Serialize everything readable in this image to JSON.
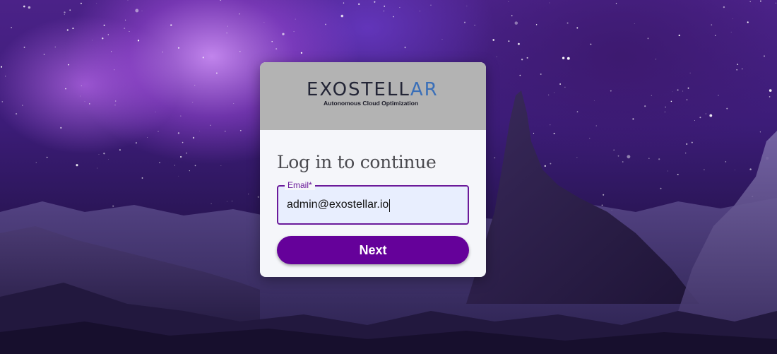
{
  "brand": {
    "logo_word_dark": "EXOSTELL",
    "logo_word_blue": "AR",
    "tagline": "Autonomous Cloud Optimization"
  },
  "login": {
    "title": "Log in to continue",
    "email_label": "Email",
    "email_required_marker": "*",
    "email_value": "admin@exostellar.io",
    "next_label": "Next"
  },
  "colors": {
    "accent": "#65019a",
    "field_border": "#6b1a9a",
    "field_fill": "#e8eefe",
    "header_gray": "#b3b3b3",
    "logo_blue": "#3a6fb8"
  }
}
